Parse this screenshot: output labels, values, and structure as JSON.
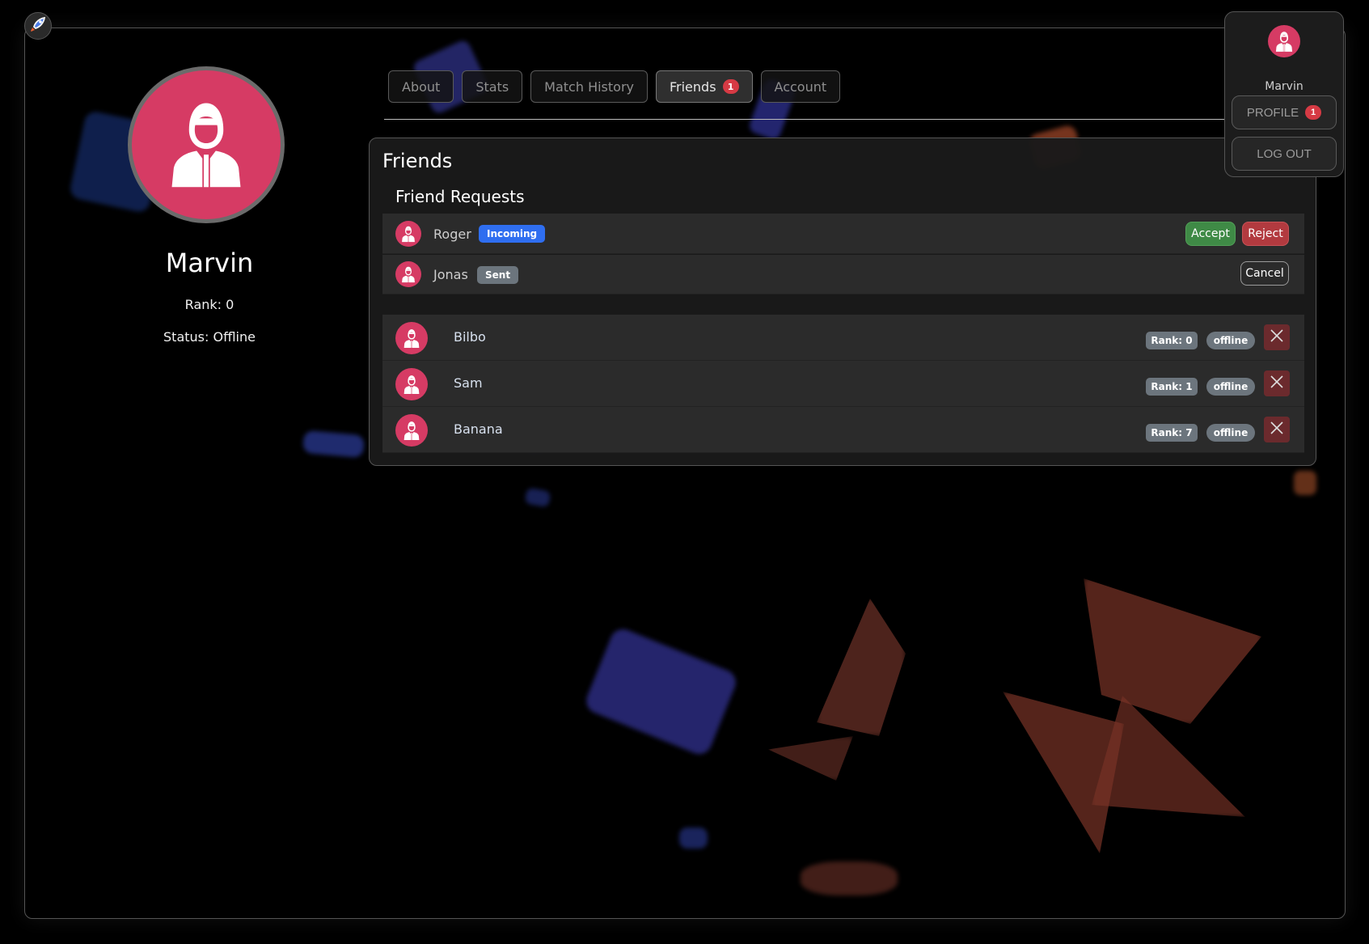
{
  "colors": {
    "accent_avatar": "#d63b64",
    "incoming_badge": "#2f6ef0",
    "accept_button": "#3f8a46",
    "reject_button": "#b23a3f",
    "notification_badge": "#d63a44"
  },
  "app": {
    "logo_icon": "rocket-icon"
  },
  "profile": {
    "name": "Marvin",
    "rank": "Rank: 0",
    "status": "Status: Offline",
    "avatar_icon": "user-avatar-icon"
  },
  "tabs": [
    {
      "label": "About",
      "active": false
    },
    {
      "label": "Stats",
      "active": false
    },
    {
      "label": "Match History",
      "active": false
    },
    {
      "label": "Friends",
      "active": true,
      "badge": "1"
    },
    {
      "label": "Account",
      "active": false
    }
  ],
  "friends_panel": {
    "title": "Friends",
    "requests_title": "Friend Requests",
    "requests": [
      {
        "name": "Roger",
        "tag": "Incoming",
        "actions": [
          "Accept",
          "Reject"
        ]
      },
      {
        "name": "Jonas",
        "tag": "Sent",
        "actions": [
          "Cancel"
        ]
      }
    ],
    "friends": [
      {
        "name": "Bilbo",
        "rank": "Rank: 0",
        "status": "offline"
      },
      {
        "name": "Sam",
        "rank": "Rank: 1",
        "status": "offline"
      },
      {
        "name": "Banana",
        "rank": "Rank: 7",
        "status": "offline"
      }
    ]
  },
  "user_menu": {
    "name": "Marvin",
    "profile_label": "PROFILE",
    "profile_badge": "1",
    "logout_label": "LOG OUT"
  }
}
